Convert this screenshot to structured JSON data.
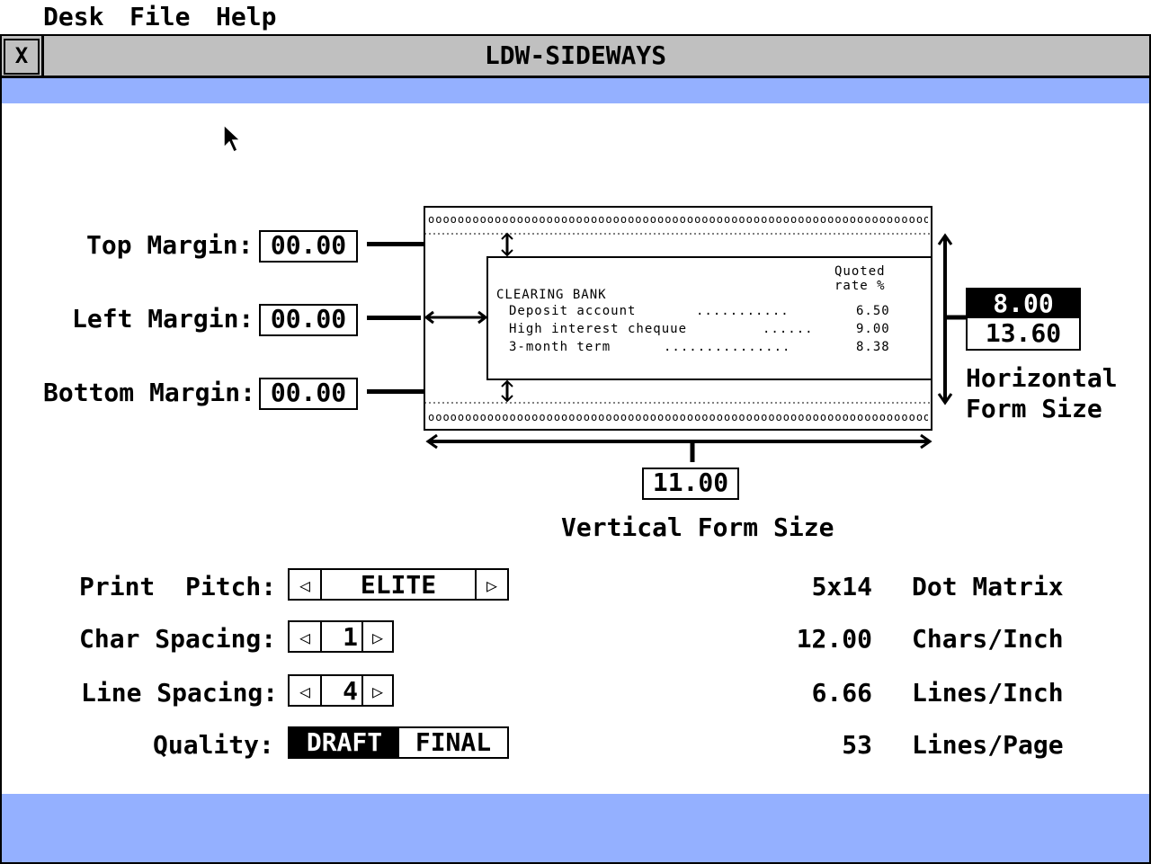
{
  "menubar": {
    "items": [
      "Desk",
      "File",
      "Help"
    ]
  },
  "window": {
    "title": "LDW-SIDEWAYS",
    "close_glyph": "X"
  },
  "margins": {
    "top_label": "Top Margin:",
    "top_value": "00.00",
    "left_label": "Left Margin:",
    "left_value": "00.00",
    "bottom_label": "Bottom Margin:",
    "bottom_value": "00.00"
  },
  "preview": {
    "header_right_1": "Quoted",
    "header_right_2": "rate %",
    "bank": "CLEARING BANK",
    "rows": [
      {
        "name": "Deposit account",
        "dots": "...........",
        "rate": "6.50"
      },
      {
        "name": "High interest chequue",
        "dots": "......",
        "rate": "9.00"
      },
      {
        "name": "3-month term",
        "dots": "...............",
        "rate": "8.38"
      }
    ],
    "sprocket": "ooooooooooooooooooooooooooooooooooooooooooooooooooooooooooooooooooooooo"
  },
  "horizontal": {
    "value_selected": "8.00",
    "value": "13.60",
    "label_1": "Horizontal",
    "label_2": "Form Size"
  },
  "vertical": {
    "value": "11.00",
    "label": "Vertical Form Size"
  },
  "settings": {
    "pitch_label": "Print  Pitch:",
    "pitch_value": "ELITE",
    "char_label": "Char Spacing:",
    "char_value": "1",
    "line_label": "Line Spacing:",
    "line_value": "4",
    "quality_label": "Quality:",
    "quality_draft": "DRAFT",
    "quality_final": "FINAL"
  },
  "info": {
    "matrix_value": "5x14",
    "matrix_label": "Dot Matrix",
    "cpi_value": "12.00",
    "cpi_label": "Chars/Inch",
    "lpi_value": "6.66",
    "lpi_label": "Lines/Inch",
    "lpp_value": "53",
    "lpp_label": "Lines/Page"
  },
  "colors": {
    "band": "#94b0ff",
    "titlebar": "#c0c0c0"
  }
}
